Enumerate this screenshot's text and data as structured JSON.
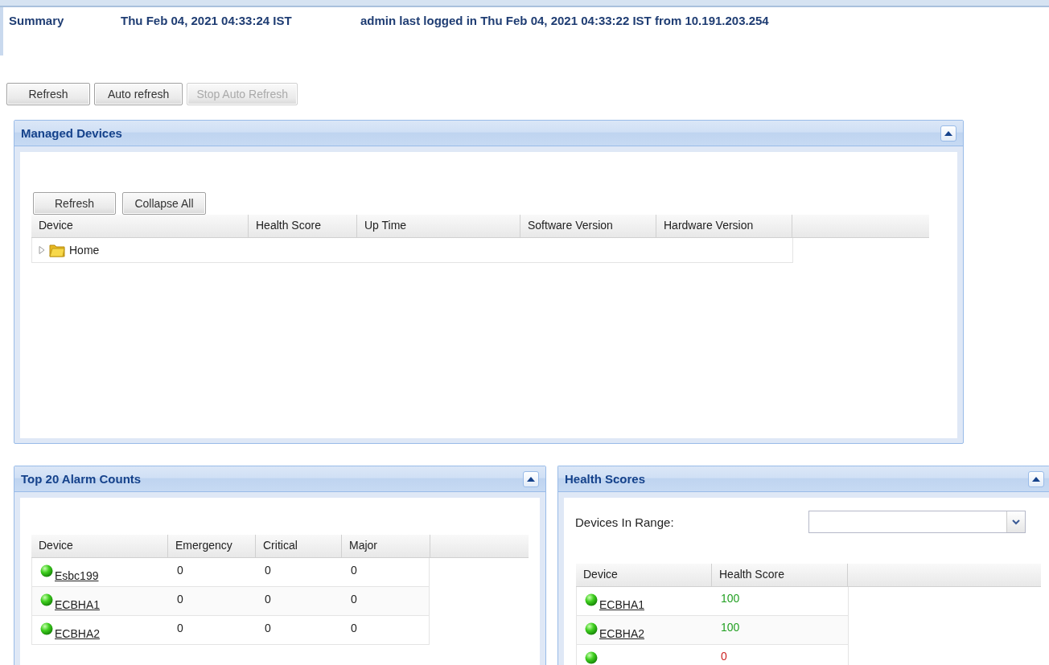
{
  "header": {
    "title": "Summary",
    "time": "Thu Feb 04, 2021 04:33:24 IST",
    "login": "admin last logged in Thu Feb 04, 2021 04:33:22 IST from 10.191.203.254"
  },
  "toolbar": [
    {
      "label": "Refresh",
      "disabled": false
    },
    {
      "label": "Auto refresh",
      "disabled": false
    },
    {
      "label": "Stop Auto Refresh",
      "disabled": true
    }
  ],
  "managed_devices": {
    "title": "Managed Devices",
    "buttons": [
      "Refresh",
      "Collapse All"
    ],
    "columns": [
      "Device",
      "Health Score",
      "Up Time",
      "Software Version",
      "Hardware Version"
    ],
    "tree": [
      {
        "label": "Home",
        "expanded": false
      }
    ]
  },
  "alarm_counts": {
    "title": "Top 20 Alarm Counts",
    "columns": [
      "Device",
      "Emergency",
      "Critical",
      "Major"
    ],
    "rows": [
      {
        "device": "Esbc199",
        "emergency": "0",
        "critical": "0",
        "major": "0"
      },
      {
        "device": "ECBHA1",
        "emergency": "0",
        "critical": "0",
        "major": "0"
      },
      {
        "device": "ECBHA2",
        "emergency": "0",
        "critical": "0",
        "major": "0"
      }
    ]
  },
  "health_scores": {
    "title": "Health Scores",
    "range_label": "Devices In Range:",
    "columns": [
      "Device",
      "Health Score"
    ],
    "rows": [
      {
        "device": "ECBHA1",
        "score": "100",
        "color": "#22a022"
      },
      {
        "device": "ECBHA2",
        "score": "100",
        "color": "#22a022"
      },
      {
        "score": "0",
        "color": "#cc2222"
      }
    ]
  }
}
